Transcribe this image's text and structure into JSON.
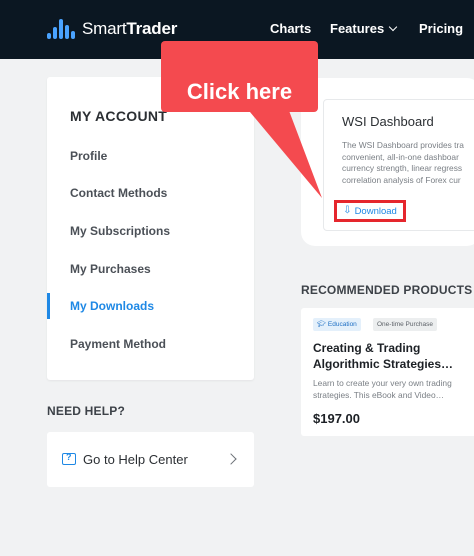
{
  "header": {
    "logo_prefix": "Smart",
    "logo_suffix": "Trader",
    "nav": {
      "charts": "Charts",
      "features": "Features",
      "pricing": "Pricing"
    }
  },
  "account": {
    "title": "MY ACCOUNT",
    "items": [
      {
        "label": "Profile",
        "active": false
      },
      {
        "label": "Contact Methods",
        "active": false
      },
      {
        "label": "My Subscriptions",
        "active": false
      },
      {
        "label": "My Purchases",
        "active": false
      },
      {
        "label": "My Downloads",
        "active": true
      },
      {
        "label": "Payment Method",
        "active": false
      }
    ]
  },
  "help": {
    "heading": "NEED HELP?",
    "link_label": "Go to Help Center"
  },
  "download_card": {
    "title": "WSI Dashboard",
    "description_lines": [
      "The WSI Dashboard provides tra",
      "convenient, all-in-one dashboar",
      "currency strength, linear regress",
      "correlation analysis of Forex cur"
    ],
    "button_label": "Download"
  },
  "recommended": {
    "heading": "RECOMMENDED PRODUCTS",
    "product": {
      "tags": [
        "Education",
        "One-time Purchase"
      ],
      "title_lines": [
        "Creating & Trading",
        "Algorithmic Strategies…"
      ],
      "description_lines": [
        "Learn to create your very own trading",
        "strategies. This eBook and Video…"
      ],
      "price": "$197.00"
    }
  },
  "callout": {
    "text": "Click here"
  },
  "colors": {
    "topbar": "#0b1722",
    "accent": "#1e88e5",
    "callout": "#f44a4f",
    "highlight_border": "#e5262d"
  }
}
